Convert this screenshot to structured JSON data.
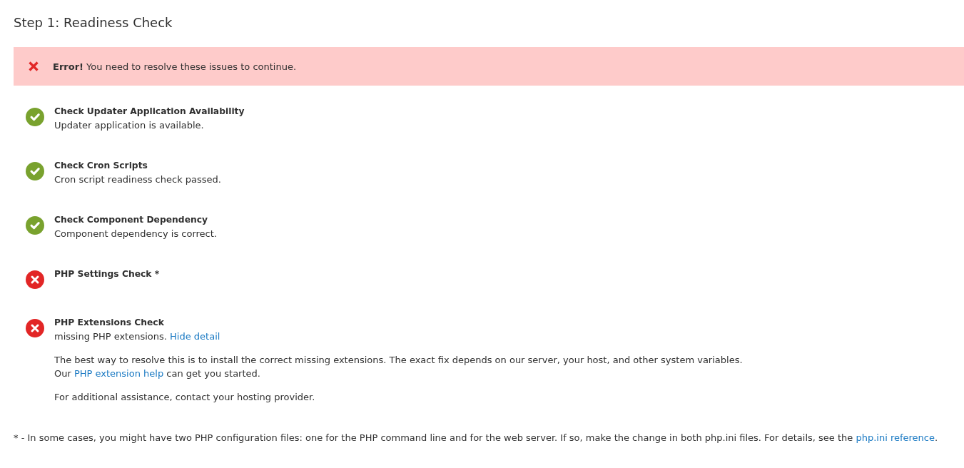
{
  "page": {
    "title": "Step 1: Readiness Check"
  },
  "alert": {
    "kind": "error",
    "message": "**Error!** You need to resolve these issues to continue."
  },
  "checks": [
    {
      "passed": true,
      "title": "Check Updater Application Availability",
      "message": [
        {
          "kind": "text",
          "text": "Updater application is available."
        }
      ]
    },
    {
      "passed": true,
      "title": "Check Cron Scripts",
      "message": [
        {
          "kind": "text",
          "text": "Cron script readiness check passed."
        }
      ]
    },
    {
      "passed": true,
      "title": "Check Component Dependency",
      "message": [
        {
          "kind": "text",
          "text": "Component dependency is correct."
        }
      ]
    },
    {
      "passed": false,
      "title": "PHP Settings Check *"
    },
    {
      "passed": false,
      "title": "PHP Extensions Check",
      "message": [
        {
          "kind": "text",
          "text": "missing PHP extensions. "
        },
        {
          "kind": "link",
          "text": "Hide detail"
        }
      ],
      "details": [
        [
          {
            "kind": "text",
            "text": "The best way to resolve this is to install the correct missing extensions. The exact fix depends on our server, your host, and other system variables."
          },
          {
            "kind": "break"
          },
          {
            "kind": "text",
            "text": "Our "
          },
          {
            "kind": "link",
            "text": "PHP extension help"
          },
          {
            "kind": "text",
            "text": " can get you started."
          }
        ],
        [
          {
            "kind": "text",
            "text": "For additional assistance, contact your hosting provider."
          }
        ]
      ]
    }
  ],
  "footnote": [
    {
      "kind": "text",
      "text": "* - In some cases, you might have two PHP configuration files: one for the PHP command line and for the web server. If so, make the change in both php.ini files. For details, see the "
    },
    {
      "kind": "link",
      "text": "php.ini reference"
    },
    {
      "kind": "text",
      "text": "."
    }
  ]
}
